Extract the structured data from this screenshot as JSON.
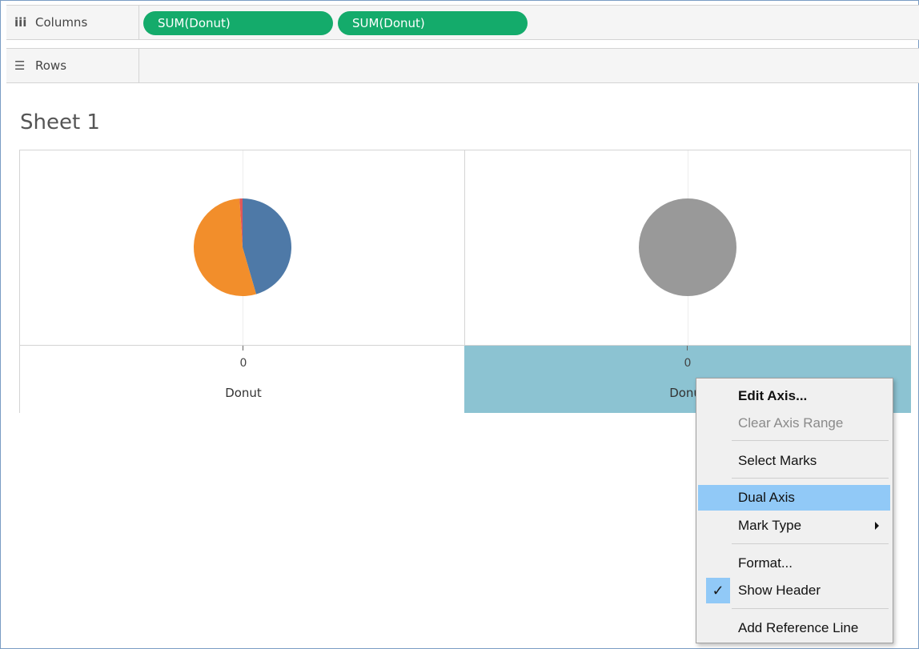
{
  "shelves": {
    "columns": {
      "label": "Columns",
      "icon": "columns-icon",
      "pills": [
        "SUM(Donut)",
        "SUM(Donut)"
      ]
    },
    "rows": {
      "label": "Rows",
      "icon": "rows-icon"
    }
  },
  "sheet": {
    "title": "Sheet 1"
  },
  "colors": {
    "pill": "#14ab6b",
    "blue": "#4e79a7",
    "orange": "#f28e2b",
    "red": "#e15759",
    "gray": "#999999",
    "axis_highlight": "#8cc3d2",
    "menu_highlight": "#91c9f7"
  },
  "panes": [
    {
      "axis_tick_label": "0",
      "axis_title": "Donut",
      "selected": false
    },
    {
      "axis_tick_label": "0",
      "axis_title": "Donut",
      "selected": true
    }
  ],
  "chart_data": [
    {
      "type": "pie",
      "slices": [
        {
          "color": "#4e79a7",
          "fraction": 0.455
        },
        {
          "color": "#f28e2b",
          "fraction": 0.535
        },
        {
          "color": "#e15759",
          "fraction": 0.01
        }
      ]
    },
    {
      "type": "pie",
      "slices": [
        {
          "color": "#999999",
          "fraction": 1.0
        }
      ]
    }
  ],
  "context_menu": {
    "items": [
      {
        "label": "Edit Axis...",
        "bold": true
      },
      {
        "label": "Clear Axis Range",
        "disabled": true
      },
      {
        "separator": true
      },
      {
        "label": "Select Marks"
      },
      {
        "separator": true
      },
      {
        "label": "Dual Axis",
        "highlighted": true
      },
      {
        "label": "Mark Type",
        "submenu": true
      },
      {
        "separator": true
      },
      {
        "label": "Format..."
      },
      {
        "label": "Show Header",
        "checked": true
      },
      {
        "separator": true
      },
      {
        "label": "Add Reference Line"
      }
    ]
  }
}
